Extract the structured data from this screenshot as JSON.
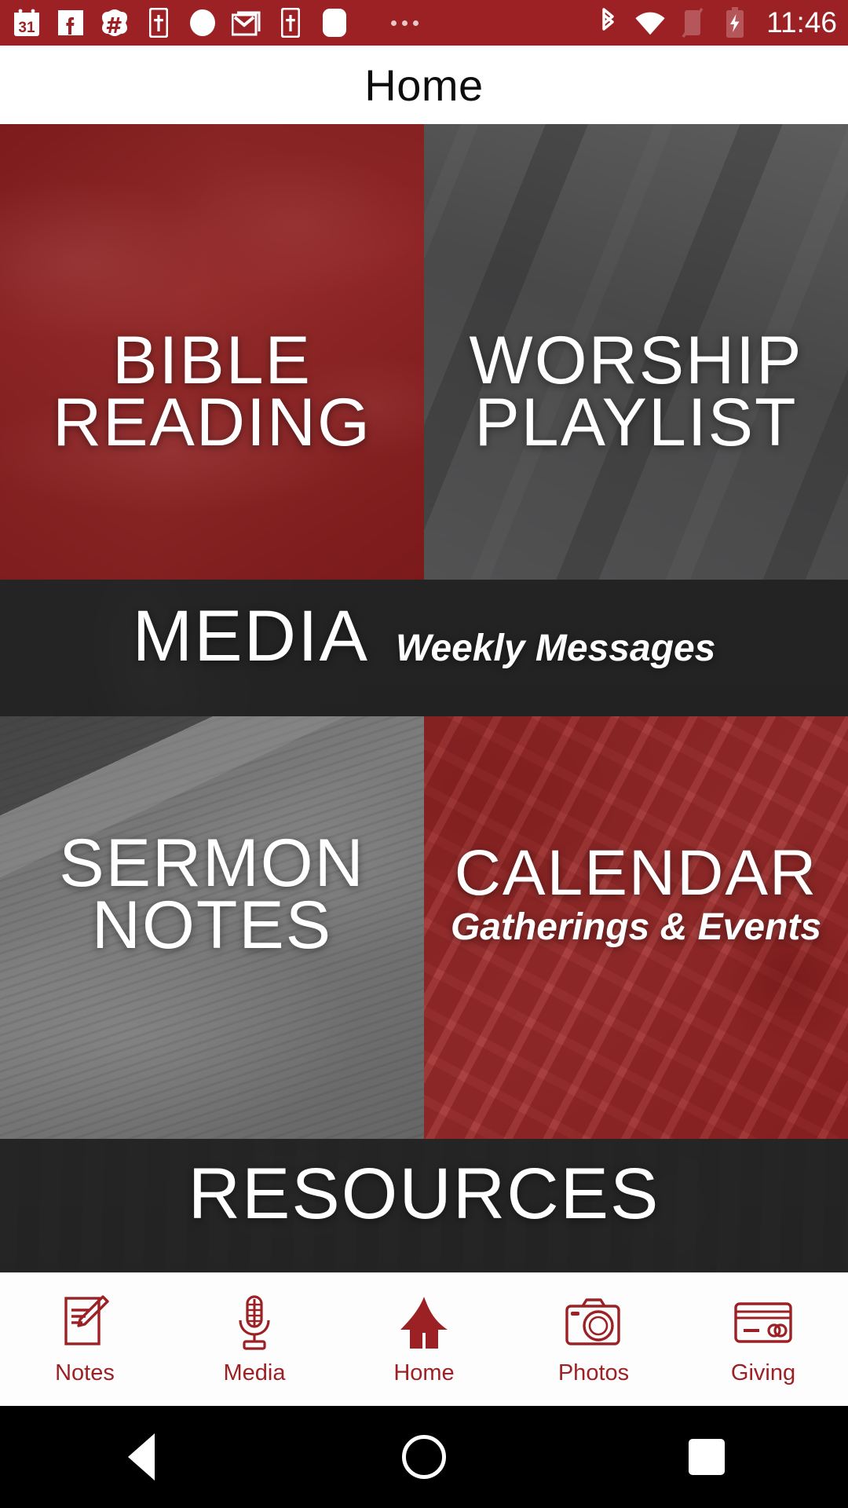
{
  "status_bar": {
    "background": "#9C2125",
    "time": "11:46",
    "left_icons": [
      {
        "name": "calendar-icon",
        "label": "31"
      },
      {
        "name": "facebook-icon",
        "label": "f"
      },
      {
        "name": "flower-badge-icon",
        "label": "#"
      },
      {
        "name": "bible-app-icon",
        "label": "†"
      },
      {
        "name": "circle-notification-icon",
        "label": ""
      },
      {
        "name": "gmail-icon",
        "label": "M"
      },
      {
        "name": "bible-app-icon-2",
        "label": "†"
      },
      {
        "name": "rounded-square-icon",
        "label": ""
      }
    ],
    "overflow_icon": "more-notifications-icon",
    "right_icons": [
      {
        "name": "bluetooth-icon"
      },
      {
        "name": "wifi-icon"
      },
      {
        "name": "silent-mode-icon"
      },
      {
        "name": "battery-charging-icon"
      }
    ]
  },
  "header": {
    "title": "Home"
  },
  "tiles": [
    {
      "name": "bible-reading",
      "title": "BIBLE\nREADING",
      "title_line1": "BIBLE",
      "title_line2": "READING",
      "subtitle": "",
      "accent": "#96171C",
      "photo": "hands-writing-in-journal"
    },
    {
      "name": "worship-playlist",
      "title_line1": "WORSHIP",
      "title_line2": "PLAYLIST",
      "subtitle": "",
      "accent": "#38383A",
      "photo": "piano-keys-grayscale"
    },
    {
      "name": "media",
      "title_line1": "MEDIA",
      "title_line2": "",
      "subtitle": "Weekly Messages",
      "accent": "#222222",
      "photo": "vintage-microphone-and-headphones"
    },
    {
      "name": "sermon-notes",
      "title_line1": "SERMON",
      "title_line2": "NOTES",
      "subtitle": "",
      "accent": "#46464A",
      "photo": "open-bible-with-pen"
    },
    {
      "name": "calendar",
      "title_line1": "CALENDAR",
      "title_line2": "",
      "subtitle": "Gatherings & Events",
      "accent": "#A01C1E",
      "photo": "laptop-keyboard-desk-with-coffee"
    },
    {
      "name": "resources",
      "title_line1": "RESOURCES",
      "title_line2": "",
      "subtitle": "",
      "accent": "#333333",
      "photo": "desk-tools-flatlay"
    }
  ],
  "bottom_nav": {
    "accent": "#9C2125",
    "active": "Home",
    "items": [
      {
        "label": "Notes",
        "icon": "notepad-pencil-icon"
      },
      {
        "label": "Media",
        "icon": "microphone-icon"
      },
      {
        "label": "Home",
        "icon": "house-icon"
      },
      {
        "label": "Photos",
        "icon": "camera-icon"
      },
      {
        "label": "Giving",
        "icon": "credit-card-icon"
      }
    ]
  },
  "system_nav": {
    "background": "#000000",
    "buttons": [
      {
        "name": "back",
        "icon": "triangle-back-icon"
      },
      {
        "name": "home",
        "icon": "circle-home-icon"
      },
      {
        "name": "recents",
        "icon": "square-recents-icon"
      }
    ]
  }
}
